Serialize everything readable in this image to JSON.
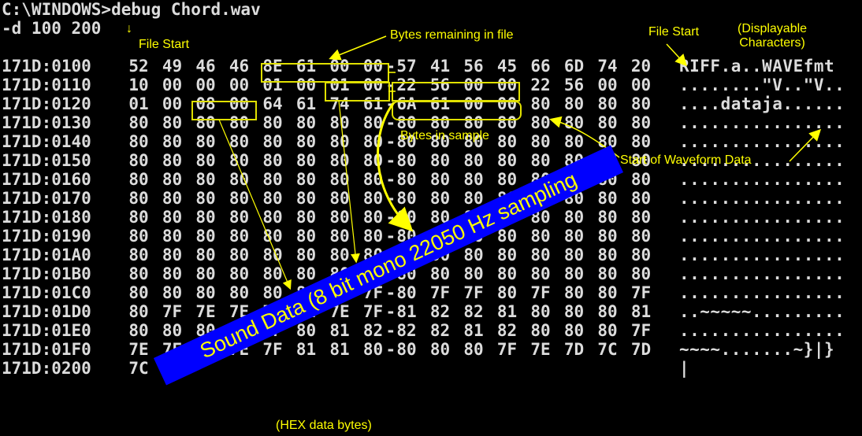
{
  "console": {
    "prompt_line": "C:\\WINDOWS>debug Chord.wav",
    "command_line": "-d 100 200",
    "rows": [
      {
        "addr": "171D:0100",
        "bytes": [
          "52",
          "49",
          "46",
          "46",
          "8E",
          "61",
          "00",
          "00",
          "57",
          "41",
          "56",
          "45",
          "66",
          "6D",
          "74",
          "20"
        ],
        "ascii": "RIFF.a..WAVEfmt "
      },
      {
        "addr": "171D:0110",
        "bytes": [
          "10",
          "00",
          "00",
          "00",
          "01",
          "00",
          "01",
          "00",
          "22",
          "56",
          "00",
          "00",
          "22",
          "56",
          "00",
          "00"
        ],
        "ascii": "........\"V..\"V.."
      },
      {
        "addr": "171D:0120",
        "bytes": [
          "01",
          "00",
          "08",
          "00",
          "64",
          "61",
          "74",
          "61",
          "6A",
          "61",
          "00",
          "00",
          "80",
          "80",
          "80",
          "80"
        ],
        "ascii": "....dataja......"
      },
      {
        "addr": "171D:0130",
        "bytes": [
          "80",
          "80",
          "80",
          "80",
          "80",
          "80",
          "80",
          "80",
          "80",
          "80",
          "80",
          "80",
          "80",
          "80",
          "80",
          "80"
        ],
        "ascii": "................"
      },
      {
        "addr": "171D:0140",
        "bytes": [
          "80",
          "80",
          "80",
          "80",
          "80",
          "80",
          "80",
          "80",
          "80",
          "80",
          "80",
          "80",
          "80",
          "80",
          "80",
          "80"
        ],
        "ascii": "................"
      },
      {
        "addr": "171D:0150",
        "bytes": [
          "80",
          "80",
          "80",
          "80",
          "80",
          "80",
          "80",
          "80",
          "80",
          "80",
          "80",
          "80",
          "80",
          "80",
          "80",
          "80"
        ],
        "ascii": "................"
      },
      {
        "addr": "171D:0160",
        "bytes": [
          "80",
          "80",
          "80",
          "80",
          "80",
          "80",
          "80",
          "80",
          "80",
          "80",
          "80",
          "80",
          "80",
          "80",
          "80",
          "80"
        ],
        "ascii": "................"
      },
      {
        "addr": "171D:0170",
        "bytes": [
          "80",
          "80",
          "80",
          "80",
          "80",
          "80",
          "80",
          "80",
          "80",
          "80",
          "80",
          "80",
          "80",
          "80",
          "80",
          "80"
        ],
        "ascii": "................"
      },
      {
        "addr": "171D:0180",
        "bytes": [
          "80",
          "80",
          "80",
          "80",
          "80",
          "80",
          "80",
          "80",
          "80",
          "80",
          "80",
          "80",
          "80",
          "80",
          "80",
          "80"
        ],
        "ascii": "................"
      },
      {
        "addr": "171D:0190",
        "bytes": [
          "80",
          "80",
          "80",
          "80",
          "80",
          "80",
          "80",
          "80",
          "80",
          "80",
          "80",
          "80",
          "80",
          "80",
          "80",
          "80"
        ],
        "ascii": "................"
      },
      {
        "addr": "171D:01A0",
        "bytes": [
          "80",
          "80",
          "80",
          "80",
          "80",
          "80",
          "80",
          "80",
          "80",
          "80",
          "80",
          "80",
          "80",
          "80",
          "80",
          "80"
        ],
        "ascii": "................"
      },
      {
        "addr": "171D:01B0",
        "bytes": [
          "80",
          "80",
          "80",
          "80",
          "80",
          "80",
          "80",
          "80",
          "80",
          "80",
          "80",
          "80",
          "80",
          "80",
          "80",
          "80"
        ],
        "ascii": "................"
      },
      {
        "addr": "171D:01C0",
        "bytes": [
          "80",
          "80",
          "80",
          "80",
          "80",
          "80",
          "80",
          "7F",
          "80",
          "7F",
          "7F",
          "80",
          "7F",
          "80",
          "80",
          "7F"
        ],
        "ascii": "................"
      },
      {
        "addr": "171D:01D0",
        "bytes": [
          "80",
          "7F",
          "7E",
          "7E",
          "7E",
          "7E",
          "7E",
          "7F",
          "81",
          "82",
          "82",
          "81",
          "80",
          "80",
          "80",
          "81"
        ],
        "ascii": "..~~~~~........."
      },
      {
        "addr": "171D:01E0",
        "bytes": [
          "80",
          "80",
          "80",
          "7F",
          "7F",
          "80",
          "81",
          "82",
          "82",
          "82",
          "81",
          "82",
          "80",
          "80",
          "80",
          "7F"
        ],
        "ascii": "................"
      },
      {
        "addr": "171D:01F0",
        "bytes": [
          "7E",
          "7E",
          "7E",
          "7E",
          "7F",
          "81",
          "81",
          "80",
          "80",
          "80",
          "80",
          "7F",
          "7E",
          "7D",
          "7C",
          "7D"
        ],
        "ascii": "~~~~.......~}|}"
      },
      {
        "addr": "171D:0200",
        "bytes": [
          "7C"
        ],
        "ascii": "|"
      }
    ]
  },
  "annotations": {
    "file_start_left": "File Start",
    "bytes_remaining": "Bytes remaining in file",
    "file_start_right": "File Start",
    "displayable": "(Displayable\nCharacters)",
    "bytes_in_sample": "Bytes in sample",
    "start_waveform": "Start of Waveform Data",
    "hex_data_bytes": "(HEX data bytes)",
    "banner": "Sound Data (8 bit mono 22050 Hz sampling"
  },
  "colors": {
    "background": "#000000",
    "text": "#dcdcdc",
    "annotation": "#ffff00",
    "banner_bg": "#0000ff"
  }
}
